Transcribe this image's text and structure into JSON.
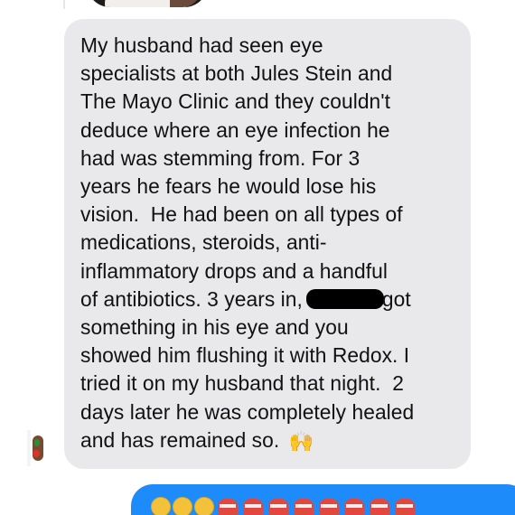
{
  "colors": {
    "incoming_bubble": "#e9e9eb",
    "outgoing_bubble": "#1d8bf9",
    "text": "#111111",
    "redaction": "#000000"
  },
  "incoming_message": {
    "line_1": "My husband had seen eye\nspecialists at both Jules Stein and\nThe Mayo Clinic and they couldn't\ndeduce where an eye infection he\nhad was stemming from. For 3\nyears he fears he would lose his\nvision.  He had been on all types of\nmedications, steroids, anti-\ninflammatory drops and a handful\nof antibiotics. 3 years in,",
    "line_2": "got\nsomething in his eye and you\nshowed him flushing it with Redox. I\ntried it on my husband that night.  2\ndays later he was completely healed\nand has remained so.",
    "emoji": "🙌",
    "emoji_icon": "raising-hands-icon",
    "redacted": true
  },
  "outgoing_message": {
    "icons": [
      "smiling-face-icon",
      "smiling-face-icon",
      "smiling-face-icon",
      "heart-icon",
      "heart-icon",
      "heart-icon",
      "heart-icon",
      "heart-icon",
      "heart-icon",
      "heart-icon",
      "heart-icon"
    ]
  }
}
